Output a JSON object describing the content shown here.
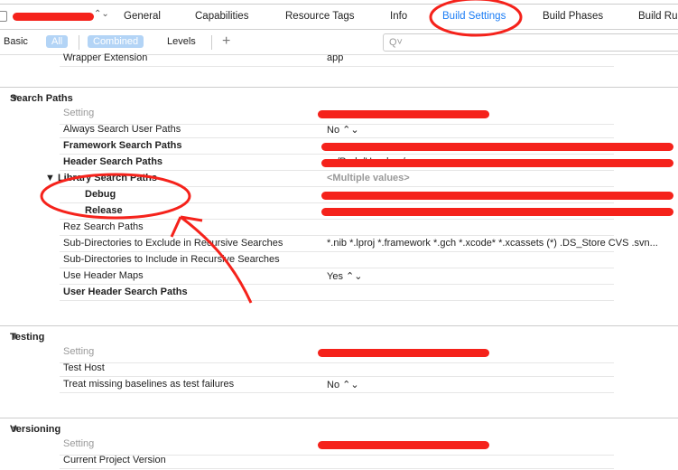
{
  "tabs": [
    "General",
    "Capabilities",
    "Resource Tags",
    "Info",
    "Build Settings",
    "Build Phases",
    "Build Ru"
  ],
  "active_tab": "Build Settings",
  "filter": {
    "basic": "Basic",
    "all": "All",
    "combined": "Combined",
    "levels": "Levels",
    "add": "+",
    "search_placeholder": "Q˅"
  },
  "top_row": {
    "label": "Wrapper Extension",
    "value": "app"
  },
  "sections": [
    {
      "title": "Search Paths",
      "rows": [
        {
          "label": "Setting",
          "value": "",
          "redacted": true,
          "header": true
        },
        {
          "label": "Always Search User Paths",
          "value": "No ⌃⌄"
        },
        {
          "label": "Framework Search Paths",
          "value": "…",
          "bold": true,
          "redacted": true
        },
        {
          "label": "Header Search Paths",
          "value": "…/Pods/Headers/…",
          "bold": true,
          "redacted": true
        },
        {
          "label": "▼ Library Search Paths",
          "value": "<Multiple values>",
          "bold": true
        },
        {
          "label": "Debug",
          "value": "…",
          "bold": true,
          "redacted": true
        },
        {
          "label": "Release",
          "value": "…",
          "bold": true,
          "redacted": true
        },
        {
          "label": "Rez Search Paths",
          "value": ""
        },
        {
          "label": "Sub-Directories to Exclude in Recursive Searches",
          "value": "*.nib *.lproj *.framework *.gch *.xcode* *.xcassets (*) .DS_Store CVS .svn..."
        },
        {
          "label": "Sub-Directories to Include in Recursive Searches",
          "value": ""
        },
        {
          "label": "Use Header Maps",
          "value": "Yes ⌃⌄"
        },
        {
          "label": "User Header Search Paths",
          "value": "",
          "bold": true
        }
      ]
    },
    {
      "title": "Testing",
      "rows": [
        {
          "label": "Setting",
          "value": "",
          "redacted": true,
          "header": true
        },
        {
          "label": "Test Host",
          "value": ""
        },
        {
          "label": "Treat missing baselines as test failures",
          "value": "No ⌃⌄"
        }
      ]
    },
    {
      "title": "Versioning",
      "rows": [
        {
          "label": "Setting",
          "value": "",
          "redacted": true,
          "header": true
        },
        {
          "label": "Current Project Version",
          "value": ""
        }
      ]
    }
  ],
  "annotation_color": "#f5221b"
}
